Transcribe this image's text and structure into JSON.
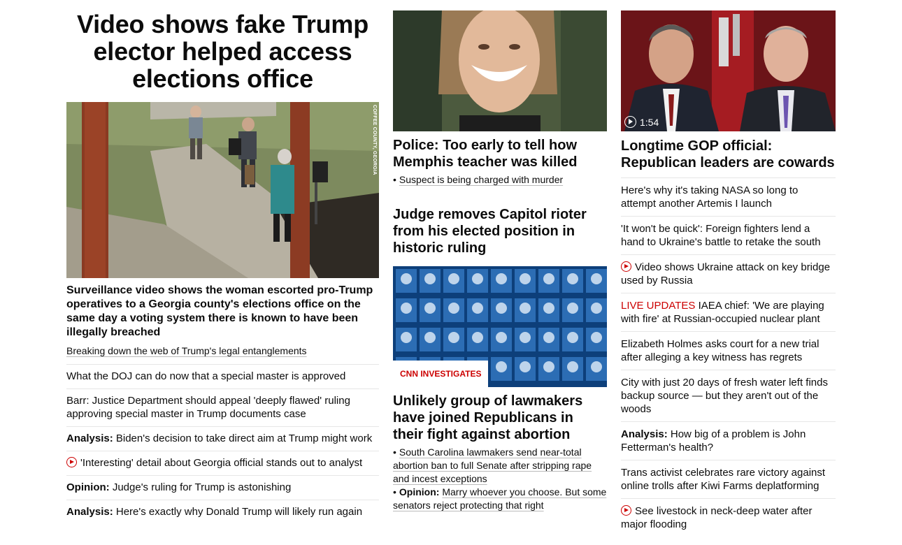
{
  "lead": {
    "headline": "Video shows fake Trump elector helped access elections office",
    "image_credit": "COFFEE COUNTY, GEORGIA",
    "description": "Surveillance video shows the woman escorted pro-Trump operatives to a Georgia county's elections office on the same day a voting system there is known to have been illegally breached",
    "related_link": "Breaking down the web of Trump's legal entanglements",
    "items": [
      {
        "label": "",
        "text": "What the DOJ can do now that a special master is approved",
        "video": false
      },
      {
        "label": "",
        "text": "Barr: Justice Department should appeal 'deeply flawed' ruling approving special master in Trump documents case",
        "video": false
      },
      {
        "label": "Analysis:",
        "text": "Biden's decision to take direct aim at Trump might work",
        "video": false
      },
      {
        "label": "",
        "text": "'Interesting' detail about Georgia official stands out to analyst",
        "video": true
      },
      {
        "label": "Opinion:",
        "text": "Judge's ruling for Trump is astonishing",
        "video": false
      },
      {
        "label": "Analysis:",
        "text": "Here's exactly why Donald Trump will likely run again",
        "video": false
      }
    ]
  },
  "middle": {
    "story1": {
      "headline": "Police: Too early to tell how Memphis teacher was killed",
      "bullet": "Suspect is being charged with murder"
    },
    "story2": {
      "headline": "Judge removes Capitol rioter from his elected position in historic ruling"
    },
    "story3": {
      "badge": "CNN INVESTIGATES",
      "headline": "Unlikely group of lawmakers have joined Republicans in their fight against abortion",
      "bullet1": "South Carolina lawmakers send near-total abortion ban to full Senate after stripping rape and incest exceptions",
      "bullet2_label": "Opinion:",
      "bullet2_text": "Marry whoever you choose. But some senators reject protecting that right"
    }
  },
  "right": {
    "video_duration": "1:54",
    "headline": "Longtime GOP official: Republican leaders are cowards",
    "items": [
      {
        "label": "",
        "live": "",
        "text": "Here's why it's taking NASA so long to attempt another Artemis I launch",
        "video": false
      },
      {
        "label": "",
        "live": "",
        "text": "'It won't be quick': Foreign fighters lend a hand to Ukraine's battle to retake the south",
        "video": false
      },
      {
        "label": "",
        "live": "",
        "text": "Video shows Ukraine attack on key bridge used by Russia",
        "video": true
      },
      {
        "label": "",
        "live": "LIVE UPDATES",
        "text": "IAEA chief: 'We are playing with fire' at Russian-occupied nuclear plant",
        "video": false
      },
      {
        "label": "",
        "live": "",
        "text": "Elizabeth Holmes asks court for a new trial after alleging a key witness has regrets",
        "video": false
      },
      {
        "label": "",
        "live": "",
        "text": "City with just 20 days of fresh water left finds backup source — but they aren't out of the woods",
        "video": false
      },
      {
        "label": "Analysis:",
        "live": "",
        "text": "How big of a problem is John Fetterman's health?",
        "video": false
      },
      {
        "label": "",
        "live": "",
        "text": "Trans activist celebrates rare victory against online trolls after Kiwi Farms deplatforming",
        "video": false
      },
      {
        "label": "",
        "live": "",
        "text": "See livestock in neck-deep water after major flooding",
        "video": true
      }
    ]
  },
  "colors": {
    "accent_red": "#cc0000",
    "text": "#0c0c0c",
    "divider": "#e6e6e6"
  }
}
